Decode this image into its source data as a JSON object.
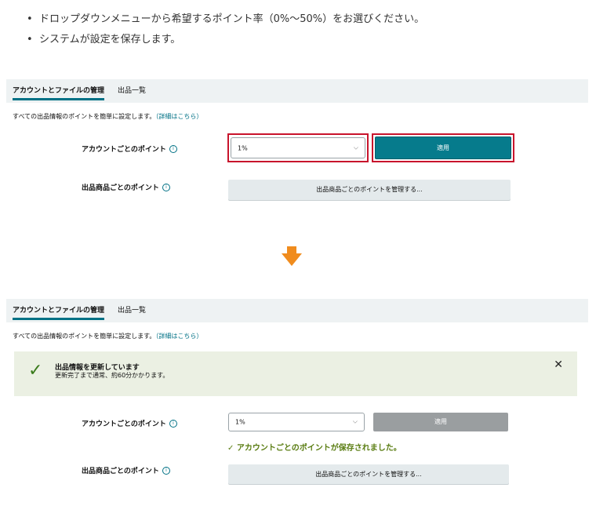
{
  "instructions": [
    "ドロップダウンメニューから希望するポイント率（0%～50%）をお選びください。",
    "システムが設定を保存します。"
  ],
  "bullet_symbol": "•",
  "before": {
    "tabs": [
      "アカウントとファイルの管理",
      "出品一覧"
    ],
    "description": "すべての出品情報のポイントを簡単に設定します。",
    "description_link": "（詳細はこちら）",
    "account_points_label": "アカウントごとのポイント",
    "account_points_value": "1%",
    "apply_label": "適用",
    "listing_points_label": "出品商品ごとのポイント",
    "manage_button_label": "出品商品ごとのポイントを管理する..."
  },
  "after": {
    "tabs": [
      "アカウントとファイルの管理",
      "出品一覧"
    ],
    "description": "すべての出品情報のポイントを簡単に設定します。",
    "description_link": "（詳細はこちら）",
    "alert_title": "出品情報を更新しています",
    "alert_body": "更新完了まで通常、約60分かかります。",
    "account_points_label": "アカウントごとのポイント",
    "account_points_value": "1%",
    "apply_label": "適用",
    "saved_message": "✓ アカウントごとのポイントが保存されました。",
    "listing_points_label": "出品商品ごとのポイント",
    "manage_button_label": "出品商品ごとのポイントを管理する..."
  },
  "icons": {
    "info": "info-circle-icon",
    "chevron": "chevron-down-icon",
    "arrow": "down-arrow-icon",
    "check": "check-icon",
    "close": "close-icon"
  },
  "colors": {
    "accent": "#067b8c",
    "highlight": "#c8142c",
    "arrow": "#f08c1e",
    "success": "#3a7b1c",
    "alert_bg": "#ebf0e3"
  }
}
